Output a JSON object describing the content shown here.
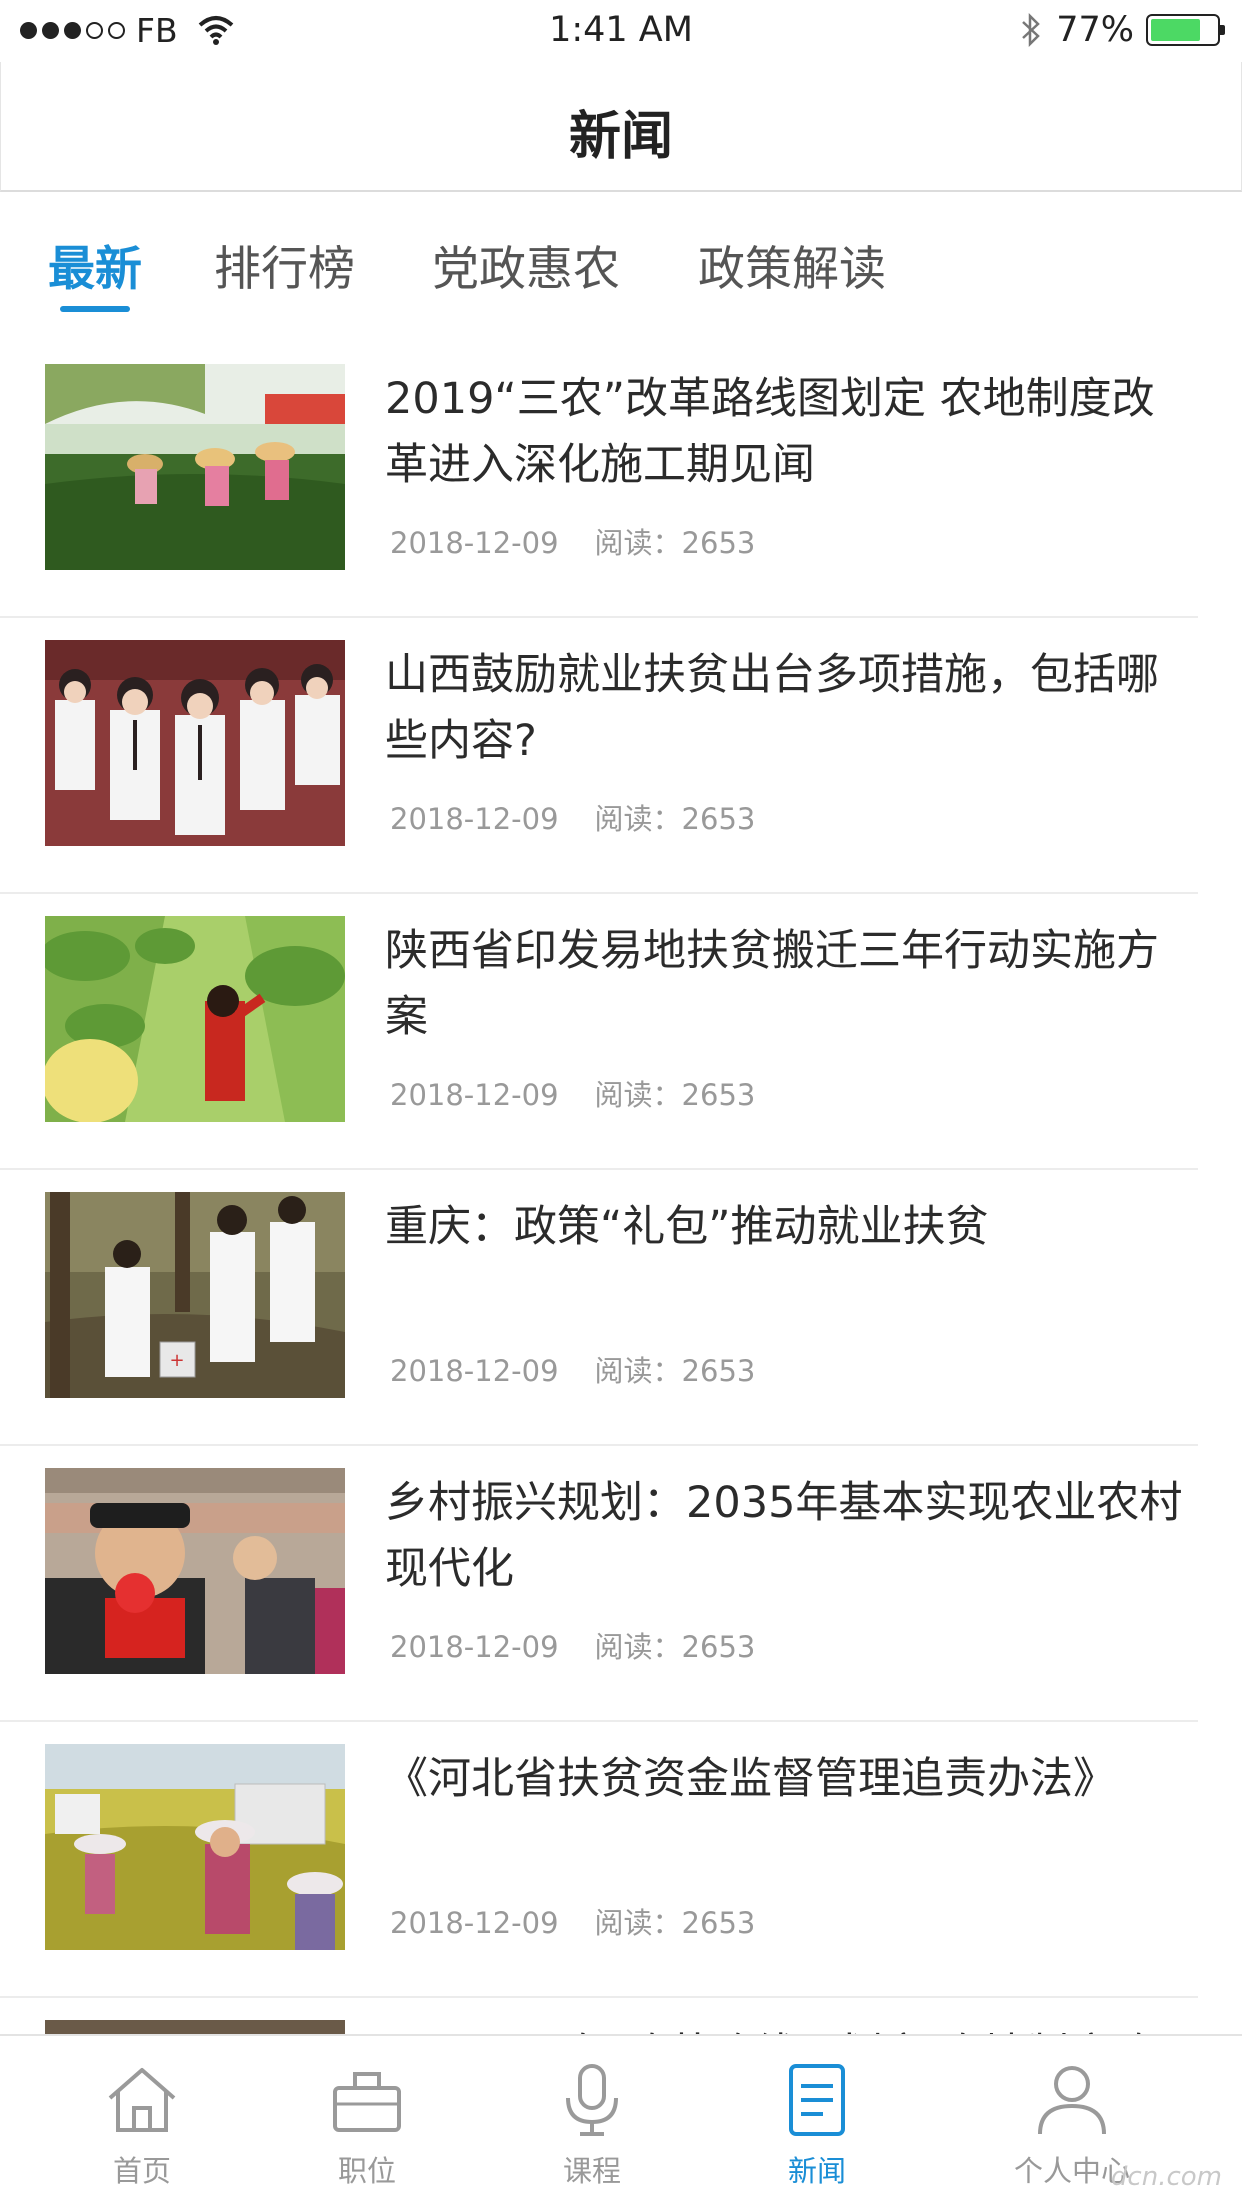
{
  "status_bar": {
    "carrier": "FB",
    "time": "1:41 AM",
    "battery_pct": "77%",
    "battery_level": 0.77
  },
  "nav": {
    "title": "新闻"
  },
  "tabs": [
    {
      "label": "最新",
      "active": true
    },
    {
      "label": "排行榜",
      "active": false
    },
    {
      "label": "党政惠农",
      "active": false
    },
    {
      "label": "政策解读",
      "active": false
    }
  ],
  "news": [
    {
      "title": "2019“三农”改革路线图划定 农地制度改革进入深化施工期见闻",
      "date": "2018-12-09",
      "reads": "阅读：2653"
    },
    {
      "title": "山西鼓励就业扶贫出台多项措施，包括哪些内容?",
      "date": "2018-12-09",
      "reads": "阅读：2653"
    },
    {
      "title": "陕西省印发易地扶贫搬迁三年行动实施方案",
      "date": "2018-12-09",
      "reads": "阅读：2653"
    },
    {
      "title": "重庆：政策“礼包”推动就业扶贫",
      "date": "2018-12-09",
      "reads": "阅读：2653"
    },
    {
      "title": "乡村振兴规划：2035年基本实现农业农村现代化",
      "date": "2018-12-09",
      "reads": "阅读：2653"
    },
    {
      "title": "《河北省扶贫资金监督管理追责办法》",
      "date": "2018-12-09",
      "reads": "阅读：2653"
    }
  ],
  "tab_bar": [
    {
      "label": "首页",
      "icon": "home-icon",
      "active": false
    },
    {
      "label": "职位",
      "icon": "briefcase-icon",
      "active": false
    },
    {
      "label": "课程",
      "icon": "microphone-icon",
      "active": false
    },
    {
      "label": "新闻",
      "icon": "news-document-icon",
      "active": true
    },
    {
      "label": "个人中心",
      "icon": "person-icon",
      "active": false
    }
  ],
  "colors": {
    "accent": "#1a8ed6",
    "inactive": "#999999",
    "title": "#2b2b2b"
  },
  "watermark": "dcn.com"
}
